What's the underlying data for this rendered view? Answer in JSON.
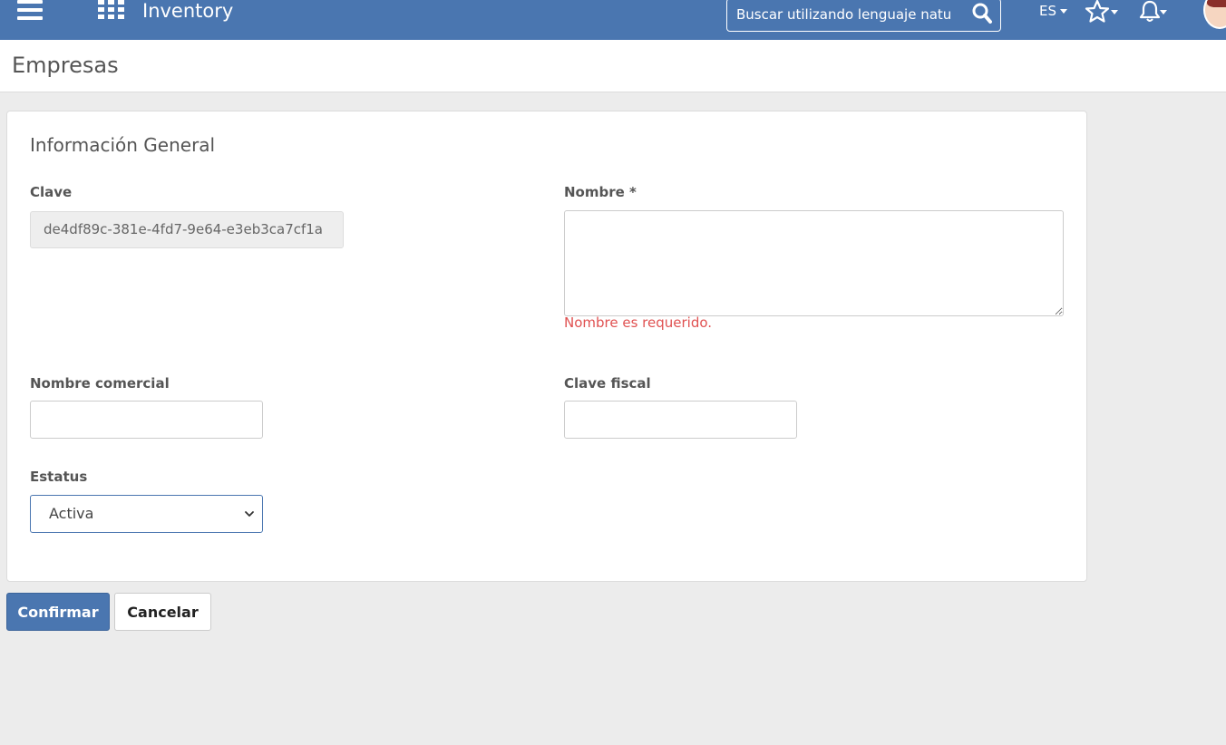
{
  "topbar": {
    "menu_icon": "hamburger-menu-icon",
    "apps_icon": "apps-grid-icon",
    "app_title": "Inventory",
    "search_placeholder": "Buscar utilizando lenguaje natural",
    "search_icon": "search-icon",
    "language": "ES",
    "favorites_icon": "star-icon",
    "notifications_icon": "bell-icon",
    "avatar_icon": "user-avatar"
  },
  "page": {
    "title": "Empresas"
  },
  "form": {
    "section_title": "Información General",
    "clave": {
      "label": "Clave",
      "value": "de4df89c-381e-4fd7-9e64-e3eb3ca7cf1a"
    },
    "nombre": {
      "label": "Nombre *",
      "value": "",
      "error": "Nombre es requerido."
    },
    "nombre_comercial": {
      "label": "Nombre comercial",
      "value": ""
    },
    "clave_fiscal": {
      "label": "Clave fiscal",
      "value": ""
    },
    "estatus": {
      "label": "Estatus",
      "selected": "Activa"
    }
  },
  "actions": {
    "confirm_label": "Confirmar",
    "cancel_label": "Cancelar"
  },
  "colors": {
    "brand": "#4a76b0",
    "error": "#e05151",
    "background": "#ececec"
  }
}
